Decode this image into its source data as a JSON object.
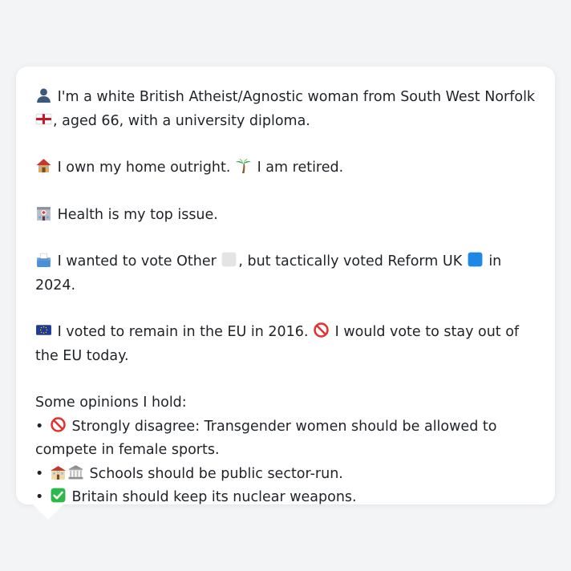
{
  "profile": {
    "intro": " I'm a white British Atheist/Agnostic woman from South West Norfolk ",
    "intro_tail": ", aged 66, with a university diploma.",
    "home": " I own my home outright. ",
    "retired": " I am retired.",
    "health": " Health is my top issue.",
    "vote_a": " I wanted to vote Other ",
    "vote_b": ", but tactically voted Reform UK ",
    "vote_c": " in 2024.",
    "eu_a": " I voted to remain in the EU in 2016. ",
    "eu_b": " I would vote to stay out of the EU today."
  },
  "opinions": {
    "heading": "Some opinions I hold:",
    "bullet": "•",
    "items": [
      " Strongly disagree: Transgender women should be allowed to compete in female sports.",
      " Schools should be public sector-run.",
      " Britain should keep its nuclear weapons."
    ]
  },
  "icons": {
    "person": "bust-in-silhouette-icon",
    "flag_england": "england-flag-icon",
    "house": "house-icon",
    "palm": "palm-tree-icon",
    "hospital": "hospital-icon",
    "ballot": "ballot-box-icon",
    "white_square": "white-square-icon",
    "blue_square": "blue-square-icon",
    "eu_flag": "eu-flag-icon",
    "prohibited": "prohibited-icon",
    "school": "school-icon",
    "classical_building": "classical-building-icon",
    "check": "check-mark-button-icon"
  },
  "colors": {
    "background": "#f3f4f6",
    "card": "#ffffff",
    "text": "#1f2328",
    "reform_blue": "#1e88e5",
    "check_green": "#2eb84b",
    "prohibited_red": "#e5302d"
  }
}
